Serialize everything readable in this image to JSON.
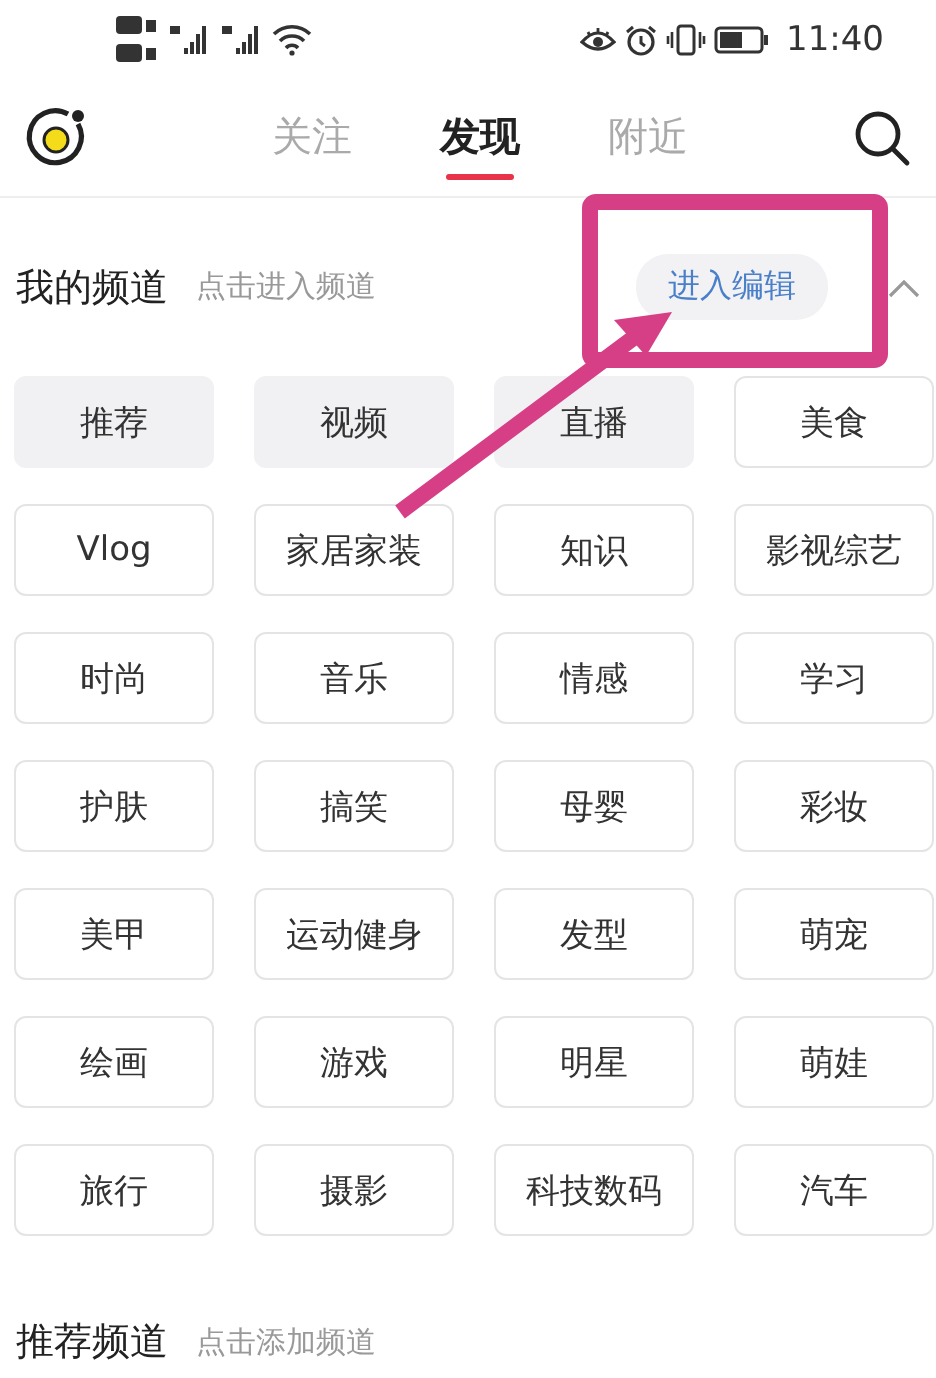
{
  "status_bar": {
    "time": "11:40"
  },
  "tabs": [
    {
      "label": "关注",
      "selected": false
    },
    {
      "label": "发现",
      "selected": true
    },
    {
      "label": "附近",
      "selected": false
    }
  ],
  "my_channels": {
    "title": "我的频道",
    "hint": "点击进入频道",
    "edit_button": "进入编辑"
  },
  "channels": [
    {
      "label": "推荐",
      "fixed": true
    },
    {
      "label": "视频",
      "fixed": true
    },
    {
      "label": "直播",
      "fixed": true
    },
    {
      "label": "美食",
      "fixed": false
    },
    {
      "label": "Vlog",
      "fixed": false
    },
    {
      "label": "家居家装",
      "fixed": false
    },
    {
      "label": "知识",
      "fixed": false
    },
    {
      "label": "影视综艺",
      "fixed": false
    },
    {
      "label": "时尚",
      "fixed": false
    },
    {
      "label": "音乐",
      "fixed": false
    },
    {
      "label": "情感",
      "fixed": false
    },
    {
      "label": "学习",
      "fixed": false
    },
    {
      "label": "护肤",
      "fixed": false
    },
    {
      "label": "搞笑",
      "fixed": false
    },
    {
      "label": "母婴",
      "fixed": false
    },
    {
      "label": "彩妆",
      "fixed": false
    },
    {
      "label": "美甲",
      "fixed": false
    },
    {
      "label": "运动健身",
      "fixed": false
    },
    {
      "label": "发型",
      "fixed": false
    },
    {
      "label": "萌宠",
      "fixed": false
    },
    {
      "label": "绘画",
      "fixed": false
    },
    {
      "label": "游戏",
      "fixed": false
    },
    {
      "label": "明星",
      "fixed": false
    },
    {
      "label": "萌娃",
      "fixed": false
    },
    {
      "label": "旅行",
      "fixed": false
    },
    {
      "label": "摄影",
      "fixed": false
    },
    {
      "label": "科技数码",
      "fixed": false
    },
    {
      "label": "汽车",
      "fixed": false
    }
  ],
  "recommended_channels": {
    "title": "推荐频道",
    "hint": "点击添加频道"
  }
}
